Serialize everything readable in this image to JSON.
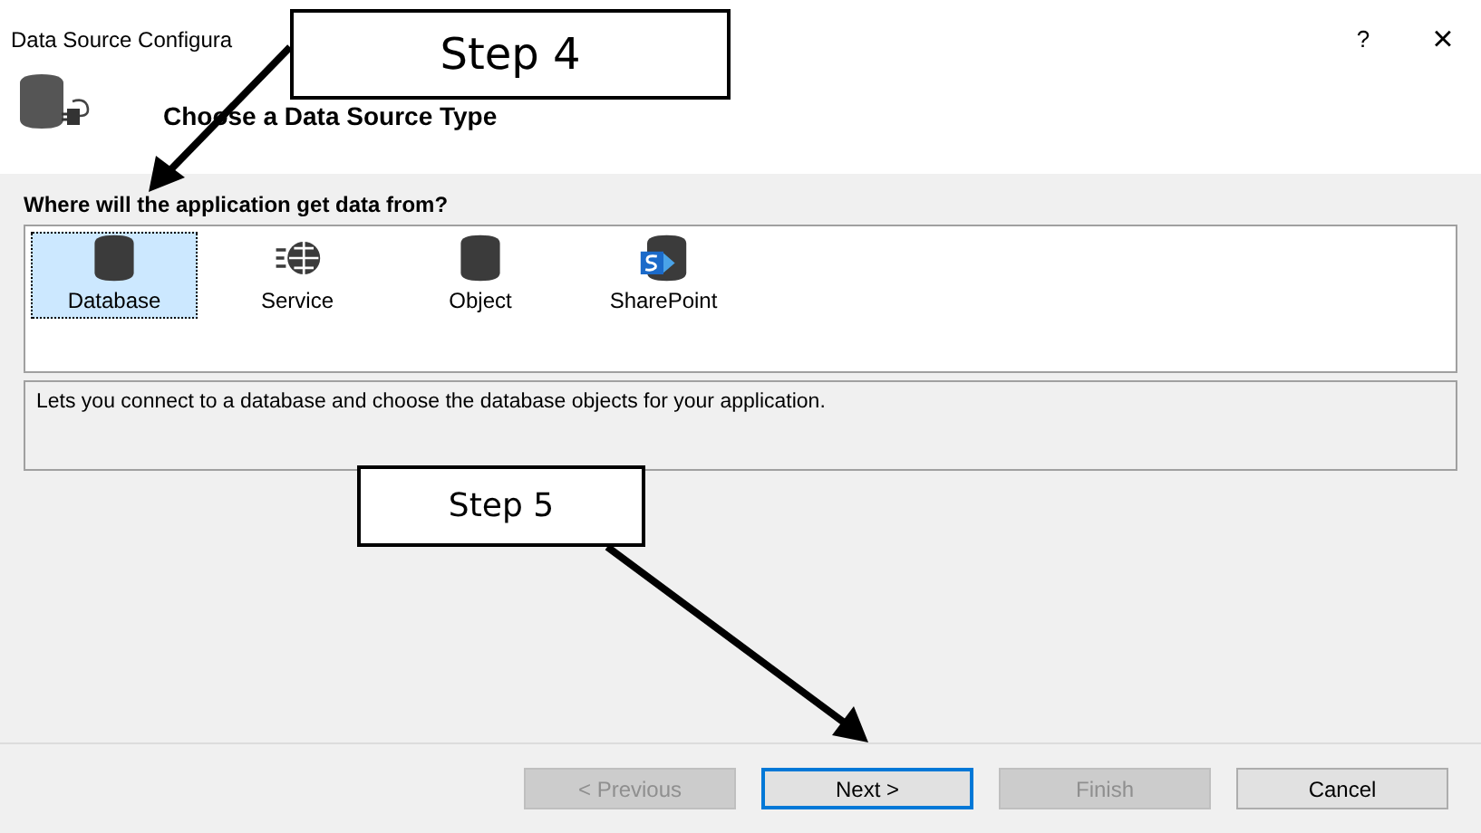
{
  "window": {
    "title": "Data Source Configura",
    "help": "?",
    "close": "×"
  },
  "header": {
    "title": "Choose a Data Source Type"
  },
  "prompt": "Where will the application get data from?",
  "sources": [
    {
      "label": "Database",
      "kind": "database",
      "selected": true
    },
    {
      "label": "Service",
      "kind": "service",
      "selected": false
    },
    {
      "label": "Object",
      "kind": "object",
      "selected": false
    },
    {
      "label": "SharePoint",
      "kind": "sharepoint",
      "selected": false
    }
  ],
  "description": "Lets you connect to a database and choose the database objects for your application.",
  "buttons": [
    {
      "label": "< Previous",
      "disabled": true,
      "default": false
    },
    {
      "label": "Next >",
      "disabled": false,
      "default": true
    },
    {
      "label": "Finish",
      "disabled": true,
      "default": false
    },
    {
      "label": "Cancel",
      "disabled": false,
      "default": false
    }
  ],
  "callouts": [
    {
      "label": "Step 4"
    },
    {
      "label": "Step 5"
    }
  ]
}
